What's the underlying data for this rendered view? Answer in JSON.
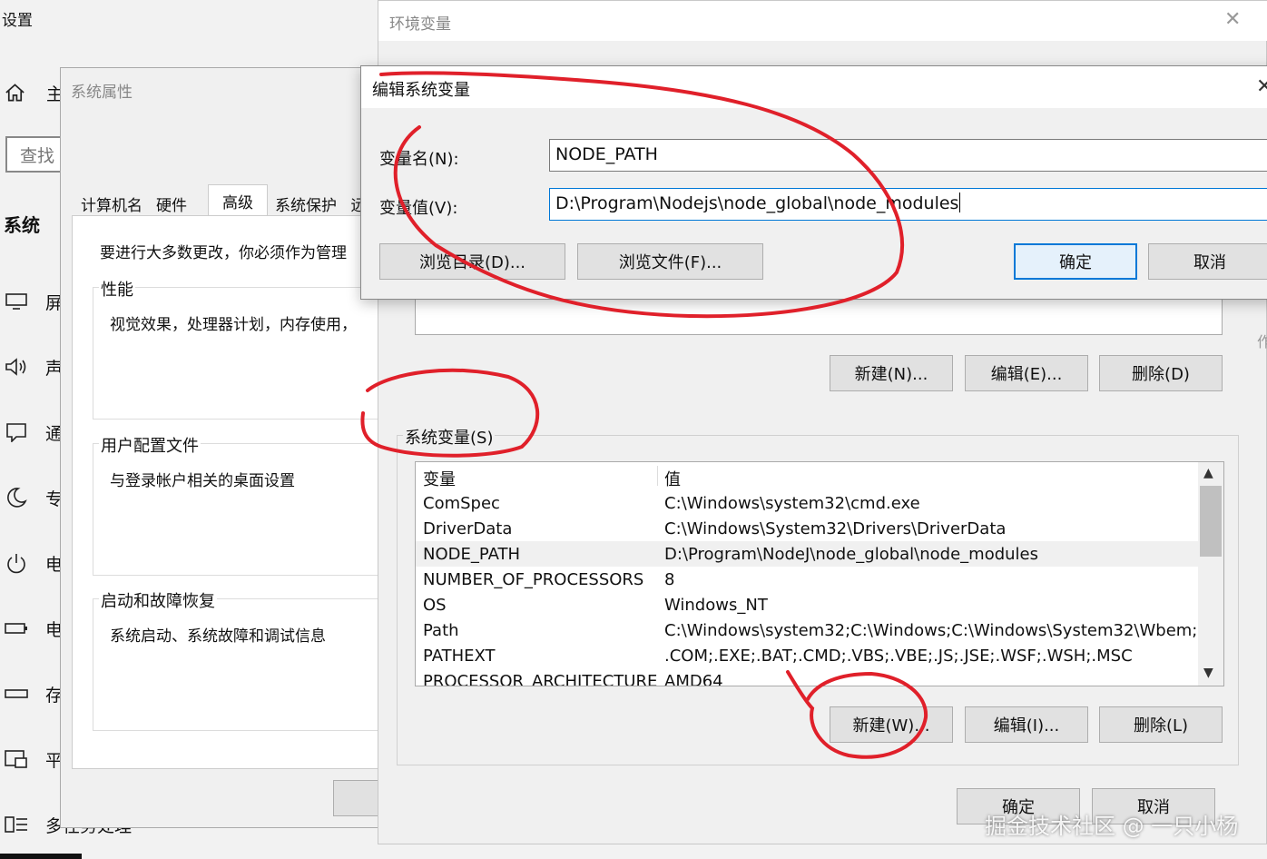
{
  "settings": {
    "title": "设置",
    "home_label": "主",
    "search_placeholder": "查找",
    "section": "系统",
    "nav": [
      {
        "label": "屏",
        "icon": "display-icon"
      },
      {
        "label": "声",
        "icon": "speaker-icon"
      },
      {
        "label": "通",
        "icon": "notification-icon"
      },
      {
        "label": "专",
        "icon": "moon-icon"
      },
      {
        "label": "电",
        "icon": "power-icon"
      },
      {
        "label": "电",
        "icon": "battery-icon"
      },
      {
        "label": "存",
        "icon": "storage-icon"
      },
      {
        "label": "平",
        "icon": "tablet-icon"
      },
      {
        "label": "多任务处理",
        "icon": "multitask-icon"
      }
    ]
  },
  "sysprops": {
    "title": "系统属性",
    "tabs": [
      "计算机名",
      "硬件",
      "高级",
      "系统保护",
      "远"
    ],
    "active_tab": "高级",
    "admin_note": "要进行大多数更改，你必须作为管理",
    "groups": [
      {
        "title": "性能",
        "desc": "视觉效果，处理器计划，内存使用，"
      },
      {
        "title": "用户配置文件",
        "desc": "与登录帐户相关的桌面设置"
      },
      {
        "title": "启动和故障恢复",
        "desc": "系统启动、系统故障和调试信息"
      }
    ]
  },
  "envvars": {
    "title": "环境变量",
    "close_glyph": "✕",
    "user_buttons": {
      "new": "新建(N)...",
      "edit": "编辑(E)...",
      "delete": "删除(D)"
    },
    "system_label": "系统变量(S)",
    "table": {
      "headers": {
        "var": "变量",
        "val": "值"
      },
      "rows": [
        {
          "var": "ComSpec",
          "val": "C:\\Windows\\system32\\cmd.exe"
        },
        {
          "var": "DriverData",
          "val": "C:\\Windows\\System32\\Drivers\\DriverData"
        },
        {
          "var": "NODE_PATH",
          "val": "D:\\Program\\NodeJ\\node_global\\node_modules"
        },
        {
          "var": "NUMBER_OF_PROCESSORS",
          "val": "8"
        },
        {
          "var": "OS",
          "val": "Windows_NT"
        },
        {
          "var": "Path",
          "val": "C:\\Windows\\system32;C:\\Windows;C:\\Windows\\System32\\Wbem;..."
        },
        {
          "var": "PATHEXT",
          "val": ".COM;.EXE;.BAT;.CMD;.VBS;.VBE;.JS;.JSE;.WSF;.WSH;.MSC"
        },
        {
          "var": "PROCESSOR_ARCHITECTURE",
          "val": "AMD64"
        }
      ],
      "selected_index": 2
    },
    "system_buttons": {
      "new": "新建(W)...",
      "edit": "编辑(I)...",
      "delete": "删除(L)"
    },
    "ok": "确定",
    "cancel": "取消",
    "side_char": "作"
  },
  "editdialog": {
    "title": "编辑系统变量",
    "close_glyph": "✕",
    "name_label": "变量名(N):",
    "name_value": "NODE_PATH",
    "value_label": "变量值(V):",
    "value_value": "D:\\Program\\Nodejs\\node_global\\node_modules",
    "browse_dir": "浏览目录(D)...",
    "browse_file": "浏览文件(F)...",
    "ok": "确定",
    "cancel": "取消"
  },
  "watermark": "掘金技术社区 @ 一只小杨",
  "annotation_color": "#e0202a"
}
